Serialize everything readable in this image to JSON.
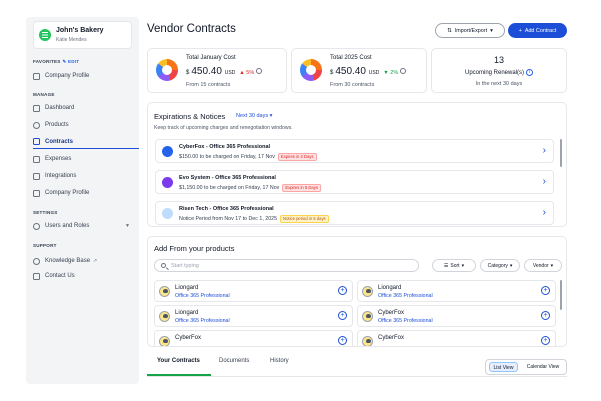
{
  "org": {
    "name": "John's Bakery",
    "user": "Katie Mendes"
  },
  "sidebar": {
    "favorites_label": "FAVORITES",
    "edit_label": "✎ EDIT",
    "favorites": [
      {
        "label": "Company Profile"
      }
    ],
    "manage_label": "MANAGE",
    "manage": [
      {
        "label": "Dashboard"
      },
      {
        "label": "Products"
      },
      {
        "label": "Contracts"
      },
      {
        "label": "Expenses"
      },
      {
        "label": "Integrations"
      },
      {
        "label": "Company Profile"
      }
    ],
    "settings_label": "SETTINGS",
    "settings": [
      {
        "label": "Users and Roles"
      }
    ],
    "support_label": "SUPPORT",
    "support": [
      {
        "label": "Knowledge Base"
      },
      {
        "label": "Contact Us"
      }
    ],
    "active_item": "Contracts"
  },
  "header": {
    "title": "Vendor Contracts",
    "import_export_label": "Import/Export",
    "add_contract_label": "Add Contract"
  },
  "cards": [
    {
      "label": "Total January Cost",
      "currency": "$",
      "value": "450.40",
      "unit": "USD",
      "change": "5%",
      "change_dir": "up",
      "sub": "From 15 contracts"
    },
    {
      "label": "Total 2025 Cost",
      "currency": "$",
      "value": "450.40",
      "unit": "USD",
      "change": "2%",
      "change_dir": "down",
      "sub": "From 30 contracts"
    },
    {
      "number": "13",
      "label": "Upcoming Renewal(s)",
      "sub": "In the next 30 days"
    }
  ],
  "expirations": {
    "title": "Expirations & Notices",
    "filter_label": "Next 30 days",
    "description": "Keep track of upcoming charges and renegotiation windows.",
    "items": [
      {
        "name": "CyberFox - Office 365 Professional",
        "detail": "$150.00 to be charged on Friday, 17 Nov",
        "badge": "Expires in 2 Days",
        "badge_tone": "red",
        "logo_color": "#2563eb"
      },
      {
        "name": "Evo System - Office 365 Professional",
        "detail": "$1,150.00 to be charged on  Friday, 17 Nov",
        "badge": "Expires in 5 Days",
        "badge_tone": "red",
        "logo_color": "#7c3aed"
      },
      {
        "name": "Risen Tech - Office 365 Professional",
        "detail": "Notice Period from Nov 17 to Dec 1, 2025",
        "badge": "Notice period in 5 days",
        "badge_tone": "amber",
        "logo_color": "#93c5fd"
      }
    ]
  },
  "products": {
    "title": "Add From your products",
    "search_placeholder": "Start typing",
    "filters": [
      {
        "label": "Sort"
      },
      {
        "label": "Category"
      },
      {
        "label": "Vendor"
      }
    ],
    "items": [
      {
        "name": "Liongard",
        "sub": "Office 365 Professional"
      },
      {
        "name": "Liongard",
        "sub": "Office 365 Professional"
      },
      {
        "name": "Liongard",
        "sub": "Office 365 Professional"
      },
      {
        "name": "CyberFox",
        "sub": "Office 365 Professional"
      },
      {
        "name": "CyberFox",
        "sub": ""
      },
      {
        "name": "CyberFox",
        "sub": ""
      }
    ]
  },
  "tabs": [
    {
      "label": "Your Contracts"
    },
    {
      "label": "Documents"
    },
    {
      "label": "History"
    }
  ],
  "view_toggle": {
    "list": "List View",
    "calendar": "Calendar View",
    "selected": "List View"
  }
}
